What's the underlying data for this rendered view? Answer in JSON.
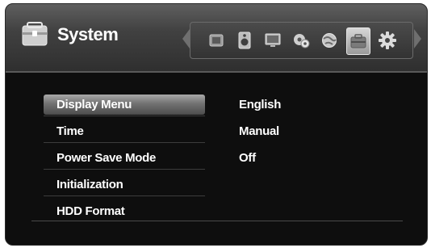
{
  "header": {
    "title": "System",
    "icon": "toolbox-icon"
  },
  "icon_bar": {
    "tabs": [
      {
        "name": "tab-photo",
        "icon": "photo-icon"
      },
      {
        "name": "tab-audio",
        "icon": "speaker-icon"
      },
      {
        "name": "tab-display",
        "icon": "monitor-icon"
      },
      {
        "name": "tab-network",
        "icon": "network-gear-icon"
      },
      {
        "name": "tab-language",
        "icon": "globe-icon"
      },
      {
        "name": "tab-system",
        "icon": "toolbox-icon",
        "active": true
      },
      {
        "name": "tab-settings",
        "icon": "gear-icon"
      }
    ]
  },
  "menu": {
    "items": [
      {
        "label": "Display Menu",
        "value": "English",
        "selected": true
      },
      {
        "label": "Time",
        "value": "Manual"
      },
      {
        "label": "Power Save Mode",
        "value": "Off"
      },
      {
        "label": "Initialization",
        "value": ""
      },
      {
        "label": "HDD Format",
        "value": ""
      }
    ]
  },
  "colors": {
    "background": "#0e0e0e",
    "header": "#414141",
    "highlight": "#8a8a8a",
    "text": "#ffffff"
  }
}
